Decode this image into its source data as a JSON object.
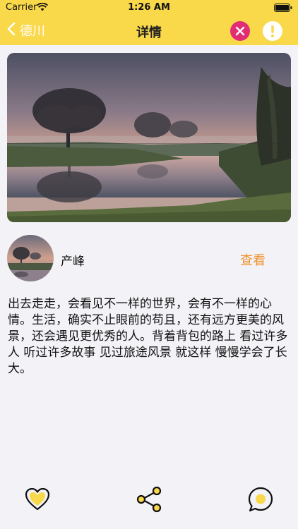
{
  "status_bar": {
    "carrier": "Carrier",
    "time": "1:26 AM"
  },
  "nav": {
    "back_label": "德川",
    "title": "详情"
  },
  "author": {
    "name": "产峰",
    "view_label": "查看"
  },
  "content": {
    "text": "出去走走，会看见不一样的世界，会有不一样的心情。生活，确实不止眼前的苟且，还有远方更美的风景，还会遇见更优秀的人。背着背包的路上 看过许多人 听过许多故事 见过旅途风景 就这样 慢慢学会了长大。"
  },
  "icons": {
    "back": "chevron-left-icon",
    "close": "close-icon",
    "alert": "exclamation-icon",
    "like": "heart-icon",
    "share": "share-icon",
    "comment": "comment-icon"
  },
  "colors": {
    "header": "#f9d84a",
    "close_button": "#e02d74",
    "accent": "#f0922d",
    "icon_fill": "#f9d84a"
  }
}
